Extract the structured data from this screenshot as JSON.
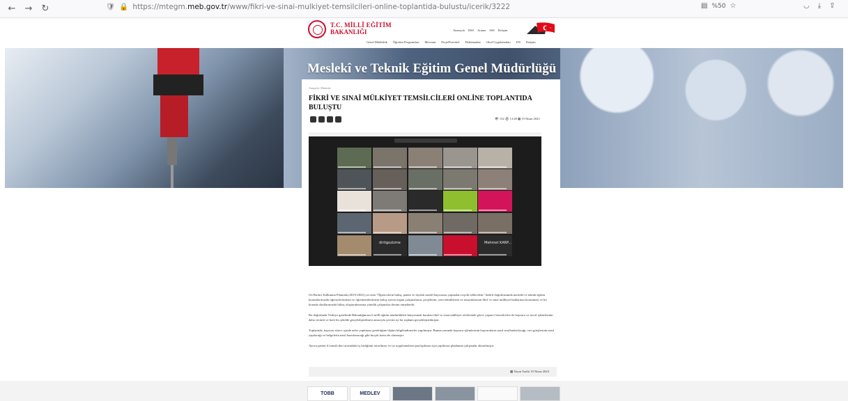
{
  "browser": {
    "url_prefix": "https://mtegm.",
    "url_domain": "meb.gov.tr",
    "url_path": "/www/fikri-ve-sinai-mulkiyet-temsilcileri-online-toplantida-bulustu/icerik/3222",
    "zoom": "%50"
  },
  "header": {
    "logo_line1": "T.C. MİLLÎ EĞİTİM",
    "logo_line2": "BAKANLIĞI",
    "top_links": [
      "Anasayfa",
      "RSS",
      "Arama",
      "SSS",
      "İletişim"
    ],
    "nav": [
      "Genel Müdürlük",
      "Öğretim Programları",
      "Mevzuat",
      "Proje/Protokol",
      "Dokümanlar",
      "Okul Uygulamaları",
      "EN",
      "İletişim"
    ]
  },
  "hero": {
    "title": "Meslekî ve Teknik Eğitim Genel Müdürlüğü"
  },
  "article": {
    "breadcrumb": "Anasayfa  |  Haberler",
    "title": "FİKRİ VE SINAİ MÜLKİYET TEMSİLCİLERİ ONLİNE TOPLANTIDA BULUŞTU",
    "views": "132",
    "time": "13:49",
    "date": "19 Nisan 2023",
    "image_tile_text_1": "dirtigozizme",
    "image_tile_text_2": "Mehmet KARP...",
    "paragraphs": [
      "On Birinci Kalkınma Planında (2019-2023) yer alan \"Öğrencilerin buluş, patent ve faydalı model başvurusu yapmaları teşvik edilecektir\" hedefi doğrultusunda meslekî ve teknik eğitim kurumlarımızda öğrencilerimizin ve öğretmenlerimizin buluş içeren özgün çalışmalarını, projelerini, yeni tekniklerini ve tasarımlarının fikrî ve sınai mülkiyet haklarının korunması ve bu konuda okullarımızda bilinç oluşturulmasına yönelik çalışmalar devam etmektedir.",
      "Bu doğrultuda Türkiye genelinde Bakanlığımıza il millî eğitim müdürlükleri bünyesinde kurulan fikrî ve sınai mülkiyet ofislerinde görev yapan il temsilcileri ile başvuru ve tescil işlemlerinin daha verimli ve hızlı bir şekilde gerçekleştirilmesi amacıyla çevrim içi bir toplantı gerçekleştirilmiştir.",
      "Toplantıda, başvuru süreci içinde neler yapılması gerektiğine ilişkin bilgilendirmeler yapılmıştır. Bunun yanında başvuru işlemlerinin başvuruların nasıl sınıflandırılacağı, veri girişlerinin nasıl yapılacağı ve belgelerin nasıl hazırlanacağı gibi birçok konu ele alınmıştır.",
      "Ayrıca patent il temsilcileri arasındaki iş birliğinin artırılması ve iyi uygulamaların paylaşılması için yapılması planlanan çalışmalar aktarılmıştır."
    ],
    "publish_label": "Yayın Tarihi 19 Nisan 2023"
  },
  "footer": {
    "partners": [
      "TOBB",
      "MEDLEV",
      "",
      "",
      "",
      ""
    ]
  },
  "colors": {
    "brand_red": "#c8102e"
  }
}
